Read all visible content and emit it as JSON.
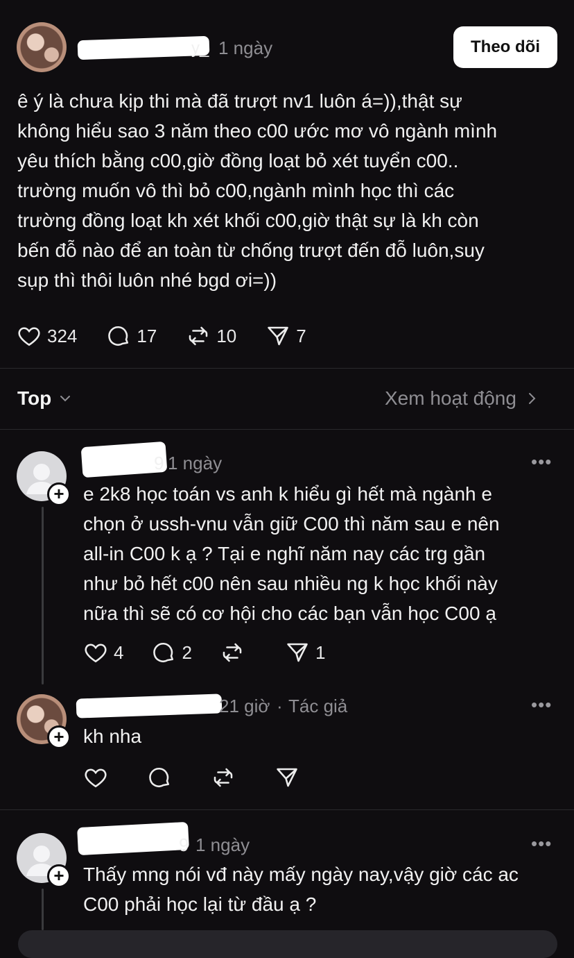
{
  "post": {
    "time": "1 ngày",
    "follow_label": "Theo dõi",
    "text": "ê ý là chưa kịp thi mà đã trượt nv1 luôn á=)),thật sự\nkhông hiểu sao 3 năm theo c00 ước mơ vô ngành mình\nyêu thích bằng c00,giờ đồng loạt bỏ xét tuyển c00..\ntrường muốn vô thì bỏ c00,ngành mình học thì các\ntrường đồng loạt kh xét khối c00,giờ thật sự là kh còn\nbến đỗ nào để an toàn từ chống trượt đến đỗ luôn,suy\nsụp thì thôi luôn nhé bgd ơi=))",
    "likes": "324",
    "comments": "17",
    "reposts": "10",
    "shares": "7",
    "username_suffix": "y_"
  },
  "sort": {
    "label": "Top",
    "activity_link": "Xem hoạt động"
  },
  "replies": [
    {
      "time": "1 ngày",
      "username_suffix": "9",
      "text": "e 2k8 học toán vs anh k hiểu gì hết mà ngành e\nchọn ở ussh-vnu vẫn giữ C00 thì năm sau e nên\nall-in C00 k ạ ? Tại e nghĩ năm nay các trg gần\nnhư bỏ hết c00 nên sau nhiều ng k học khối này\nnữa thì sẽ có cơ hội cho các bạn vẫn học C00 ạ",
      "likes": "4",
      "comments": "2",
      "shares": "1"
    },
    {
      "time": "21 giờ",
      "author_tag": "Tác giả",
      "text": "kh nha"
    },
    {
      "time": "1 ngày",
      "username_suffix": "9",
      "text": "Thấy mng nói vđ này mấy ngày nay,vậy giờ các ac\nC00 phải học lại từ đầu ạ ?"
    }
  ],
  "more_glyph": "•••",
  "meta_sep": "·",
  "icons": [
    "heart-icon",
    "comment-icon",
    "repost-icon",
    "share-icon",
    "chevron-down-icon",
    "chevron-right-icon",
    "more-icon",
    "follow-plus-icon",
    "default-avatar-icon"
  ]
}
